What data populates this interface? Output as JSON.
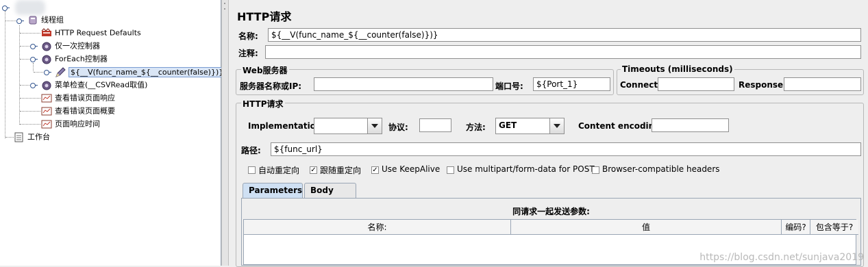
{
  "tree": {
    "items": [
      {
        "label": "线程组",
        "icon": "thread-group-icon"
      },
      {
        "label": "HTTP Request Defaults",
        "icon": "http-defaults-icon"
      },
      {
        "label": "仅一次控制器",
        "icon": "controller-icon"
      },
      {
        "label": "ForEach控制器",
        "icon": "controller-icon"
      },
      {
        "label": "${__V(func_name_${__counter(false)})}",
        "icon": "sampler-pen-icon"
      },
      {
        "label": "菜单检查(__CSVRead取值)",
        "icon": "controller-icon"
      },
      {
        "label": "查看错误页面响应",
        "icon": "listener-icon"
      },
      {
        "label": "查看错误页面概要",
        "icon": "listener-icon"
      },
      {
        "label": "页面响应时间",
        "icon": "listener-icon"
      },
      {
        "label": "工作台",
        "icon": "workbench-icon"
      }
    ]
  },
  "panel": {
    "title": "HTTP请求",
    "name_label": "名称:",
    "name_value": "${__V(func_name_${__counter(false)})}",
    "comment_label": "注释:",
    "comment_value": "",
    "web_server": {
      "title": "Web服务器",
      "server_label": "服务器名称或IP:",
      "server_value": "",
      "port_label": "端口号:",
      "port_value": "${Port_1}"
    },
    "timeouts": {
      "title": "Timeouts (milliseconds)",
      "connect_label": "Connect:",
      "connect_value": "",
      "response_label": "Response:",
      "response_value": ""
    },
    "http_request": {
      "title": "HTTP请求",
      "impl_label": "Implementation:",
      "impl_value": "",
      "protocol_label": "协议:",
      "protocol_value": "",
      "method_label": "方法:",
      "method_value": "GET",
      "encoding_label": "Content encoding:",
      "encoding_value": "",
      "path_label": "路径:",
      "path_value": "${func_url}"
    },
    "options": [
      {
        "label": "自动重定向",
        "checked": false
      },
      {
        "label": "跟随重定向",
        "checked": true
      },
      {
        "label": "Use KeepAlive",
        "checked": true
      },
      {
        "label": "Use multipart/form-data for POST",
        "checked": false
      },
      {
        "label": "Browser-compatible headers",
        "checked": false
      }
    ],
    "tabs": [
      {
        "label": "Parameters",
        "active": true
      },
      {
        "label": "Body Data",
        "active": false
      }
    ],
    "params_caption": "同请求一起发送参数:",
    "columns": [
      "名称:",
      "值",
      "编码?",
      "包含等于?"
    ]
  },
  "watermark": "https://blog.csdn.net/sunjava2019",
  "colors": {
    "selection": "#d9e5f5",
    "tab_active": "#cfe0f3",
    "border": "#9aa6b5"
  }
}
